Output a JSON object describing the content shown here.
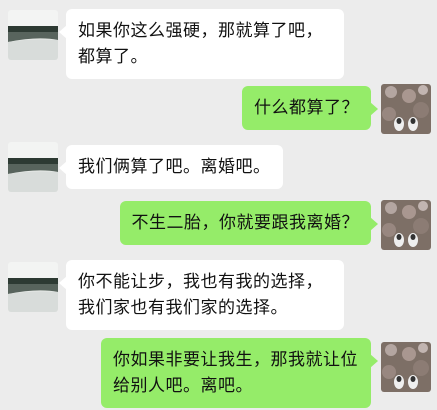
{
  "messages": [
    {
      "side": "left",
      "text": "如果你这么强硬，那就算了吧，都算了。"
    },
    {
      "side": "right",
      "text": "什么都算了？"
    },
    {
      "side": "left",
      "text": "我们俩算了吧。离婚吧。"
    },
    {
      "side": "right",
      "text": "不生二胎，你就要跟我离婚？"
    },
    {
      "side": "left",
      "text": "你不能让步，我也有我的选择，我们家也有我们家的选择。"
    },
    {
      "side": "right",
      "text": "你如果非要让我生，那我就让位给别人吧。离吧。"
    }
  ],
  "avatars": {
    "left": "landscape-avatar",
    "right": "shoes-on-flowers-avatar"
  },
  "colors": {
    "background": "#ececec",
    "left_bubble": "#ffffff",
    "right_bubble": "#95ec69"
  }
}
